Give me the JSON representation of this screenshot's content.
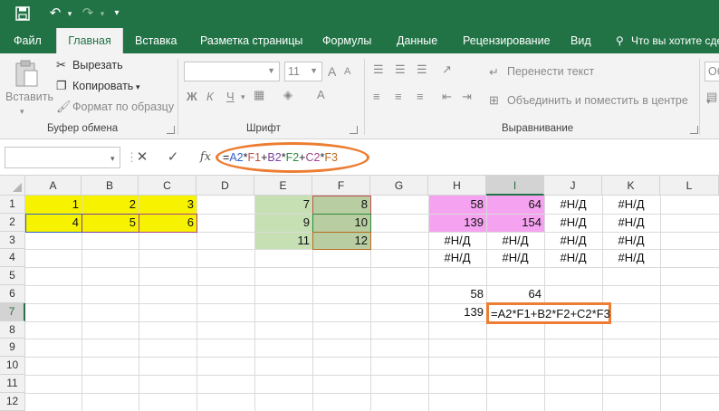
{
  "quick_access": {
    "save_icon": "save-icon",
    "undo_icon": "undo-icon",
    "redo_icon": "redo-icon",
    "customize_icon": "customize-qat-icon"
  },
  "tabs": [
    {
      "label": "Файл"
    },
    {
      "label": "Главная",
      "active": true
    },
    {
      "label": "Вставка"
    },
    {
      "label": "Разметка страницы"
    },
    {
      "label": "Формулы"
    },
    {
      "label": "Данные"
    },
    {
      "label": "Рецензирование"
    },
    {
      "label": "Вид"
    },
    {
      "label": "Что вы хотите сде"
    }
  ],
  "ribbon": {
    "clipboard": {
      "paste_label": "Вставить",
      "cut_label": "Вырезать",
      "copy_label": "Копировать",
      "format_painter_label": "Формат по образцу",
      "group_label": "Буфер обмена"
    },
    "font": {
      "size_value": "11",
      "bold": "Ж",
      "italic": "К",
      "underline": "Ч",
      "grow": "A",
      "shrink": "A",
      "group_label": "Шрифт"
    },
    "alignment": {
      "wrap_label": "Перенести текст",
      "merge_label": "Объединить и поместить в центре",
      "group_label": "Выравнивание"
    },
    "number": {
      "format_value": "Об"
    }
  },
  "formula_bar": {
    "cancel_icon": "✕",
    "enter_icon": "✓",
    "fx_label": "fx",
    "formula_parts": [
      {
        "text": "=",
        "color": "#222222"
      },
      {
        "text": "A2",
        "color": "#2e5fc9"
      },
      {
        "text": "*",
        "color": "#222222"
      },
      {
        "text": "F1",
        "color": "#c0504d"
      },
      {
        "text": "+",
        "color": "#222222"
      },
      {
        "text": "B2",
        "color": "#7a3fa0"
      },
      {
        "text": "*",
        "color": "#222222"
      },
      {
        "text": "F2",
        "color": "#2e8b3a"
      },
      {
        "text": "+",
        "color": "#222222"
      },
      {
        "text": "C2",
        "color": "#a4418a"
      },
      {
        "text": "*",
        "color": "#222222"
      },
      {
        "text": "F3",
        "color": "#b86a20"
      }
    ]
  },
  "columns": [
    "A",
    "B",
    "C",
    "D",
    "E",
    "F",
    "G",
    "H",
    "I",
    "J",
    "K",
    "L"
  ],
  "selected_column": "I",
  "rows": [
    "1",
    "2",
    "3",
    "4",
    "5",
    "6",
    "7",
    "8",
    "9",
    "10",
    "11",
    "12"
  ],
  "selected_row": "7",
  "cells": {
    "A1": "1",
    "B1": "2",
    "C1": "3",
    "A2": "4",
    "B2": "5",
    "C2": "6",
    "E1": "7",
    "F1": "8",
    "E2": "9",
    "F2": "10",
    "E3": "11",
    "F3": "12",
    "H1": "58",
    "I1": "64",
    "J1": "#Н/Д",
    "K1": "#Н/Д",
    "H2": "139",
    "I2": "154",
    "J2": "#Н/Д",
    "K2": "#Н/Д",
    "H3": "#Н/Д",
    "I3": "#Н/Д",
    "J3": "#Н/Д",
    "K3": "#Н/Д",
    "H4": "#Н/Д",
    "I4": "#Н/Д",
    "J4": "#Н/Д",
    "K4": "#Н/Д",
    "H6": "58",
    "I6": "64",
    "H7": "139",
    "I7": "=A2*F1+B2*F2+C2*F3"
  },
  "colors": {
    "brand": "#217346",
    "accent_highlight": "#ec7d32",
    "yellow_fill": "#f6f200",
    "green_fill": "#c6e0b4",
    "pink_fill": "#f5a3f0"
  }
}
